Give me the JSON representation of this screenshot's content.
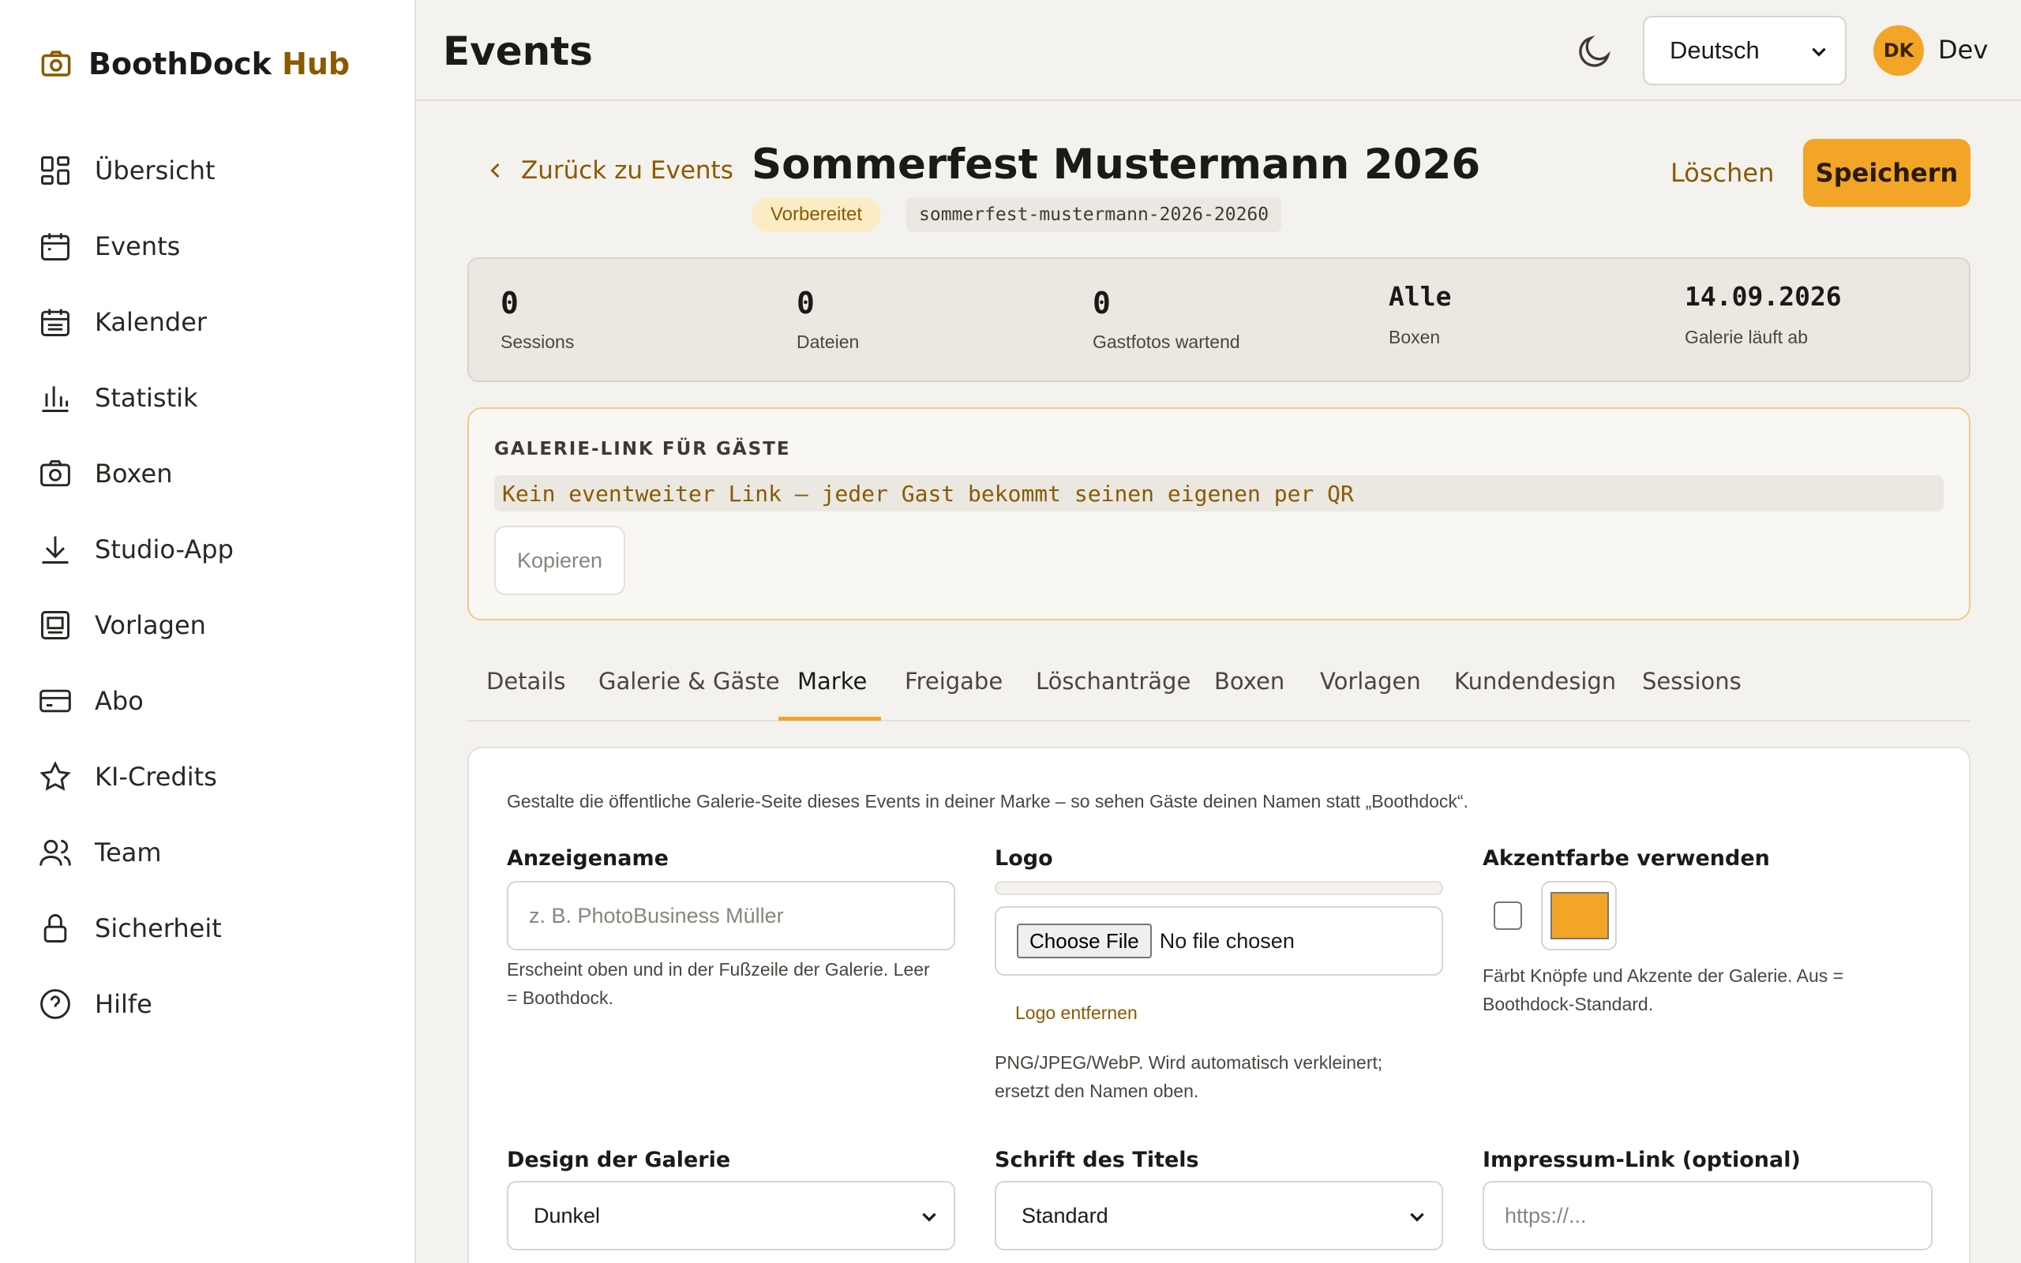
{
  "brand": {
    "name": "BoothDock",
    "accent_name": "Hub"
  },
  "sidebar": {
    "items": [
      {
        "label": "Übersicht",
        "icon": "grid-icon"
      },
      {
        "label": "Events",
        "icon": "calendar-icon"
      },
      {
        "label": "Kalender",
        "icon": "calendar-list-icon"
      },
      {
        "label": "Statistik",
        "icon": "bar-chart-icon"
      },
      {
        "label": "Boxen",
        "icon": "camera-icon"
      },
      {
        "label": "Studio-App",
        "icon": "download-icon"
      },
      {
        "label": "Vorlagen",
        "icon": "template-icon"
      },
      {
        "label": "Abo",
        "icon": "credit-card-icon"
      },
      {
        "label": "KI-Credits",
        "icon": "star-icon"
      },
      {
        "label": "Team",
        "icon": "users-icon"
      },
      {
        "label": "Sicherheit",
        "icon": "lock-icon"
      },
      {
        "label": "Hilfe",
        "icon": "help-circle-icon"
      }
    ]
  },
  "topbar": {
    "title": "Events",
    "language": "Deutsch",
    "user_initials": "DK",
    "user_name": "Dev"
  },
  "header": {
    "back_label": "Zurück zu Events",
    "event_title": "Sommerfest Mustermann 2026",
    "status": "Vorbereitet",
    "slug": "sommerfest-mustermann-2026-20260",
    "delete_label": "Löschen",
    "save_label": "Speichern"
  },
  "stats": [
    {
      "value": "0",
      "label": "Sessions"
    },
    {
      "value": "0",
      "label": "Dateien"
    },
    {
      "value": "0",
      "label": "Gastfotos wartend"
    },
    {
      "value": "Alle",
      "label": "Boxen"
    },
    {
      "value": "14.09.2026",
      "label": "Galerie läuft ab"
    }
  ],
  "gallery_link": {
    "heading": "GALERIE-LINK FÜR GÄSTE",
    "value": "Kein eventweiter Link – jeder Gast bekommt seinen eigenen per QR",
    "copy_label": "Kopieren"
  },
  "tabs": [
    {
      "label": "Details"
    },
    {
      "label": "Galerie & Gäste"
    },
    {
      "label": "Marke",
      "active": true
    },
    {
      "label": "Freigabe"
    },
    {
      "label": "Löschanträge"
    },
    {
      "label": "Boxen"
    },
    {
      "label": "Vorlagen"
    },
    {
      "label": "Kundendesign"
    },
    {
      "label": "Sessions"
    }
  ],
  "form": {
    "intro": "Gestalte die öffentliche Galerie-Seite dieses Events in deiner Marke – so sehen Gäste deinen Namen statt „Boothdock“.",
    "display_name": {
      "label": "Anzeigename",
      "placeholder": "z. B. PhotoBusiness Müller",
      "help_line1": "Erscheint oben und in der Fußzeile der Galerie. Leer",
      "help_line2": "= Boothdock."
    },
    "logo": {
      "label": "Logo",
      "file_button": "Choose File",
      "file_status": "No file chosen",
      "remove_label": "Logo entfernen",
      "help_line1": "PNG/JPEG/WebP. Wird automatisch verkleinert;",
      "help_line2": "ersetzt den Namen oben."
    },
    "accent": {
      "label": "Akzentfarbe verwenden",
      "enabled": false,
      "color": "#f2a526",
      "help_line1": "Färbt Knöpfe und Akzente der Galerie. Aus =",
      "help_line2": "Boothdock-Standard."
    },
    "design": {
      "label": "Design der Galerie",
      "value": "Dunkel"
    },
    "font": {
      "label": "Schrift des Titels",
      "value": "Standard"
    },
    "imprint": {
      "label": "Impressum-Link (optional)",
      "placeholder": "https://..."
    }
  },
  "colors": {
    "accent": "#f2a526",
    "accent_text": "#8a5a00",
    "background": "#f4f2ee"
  }
}
